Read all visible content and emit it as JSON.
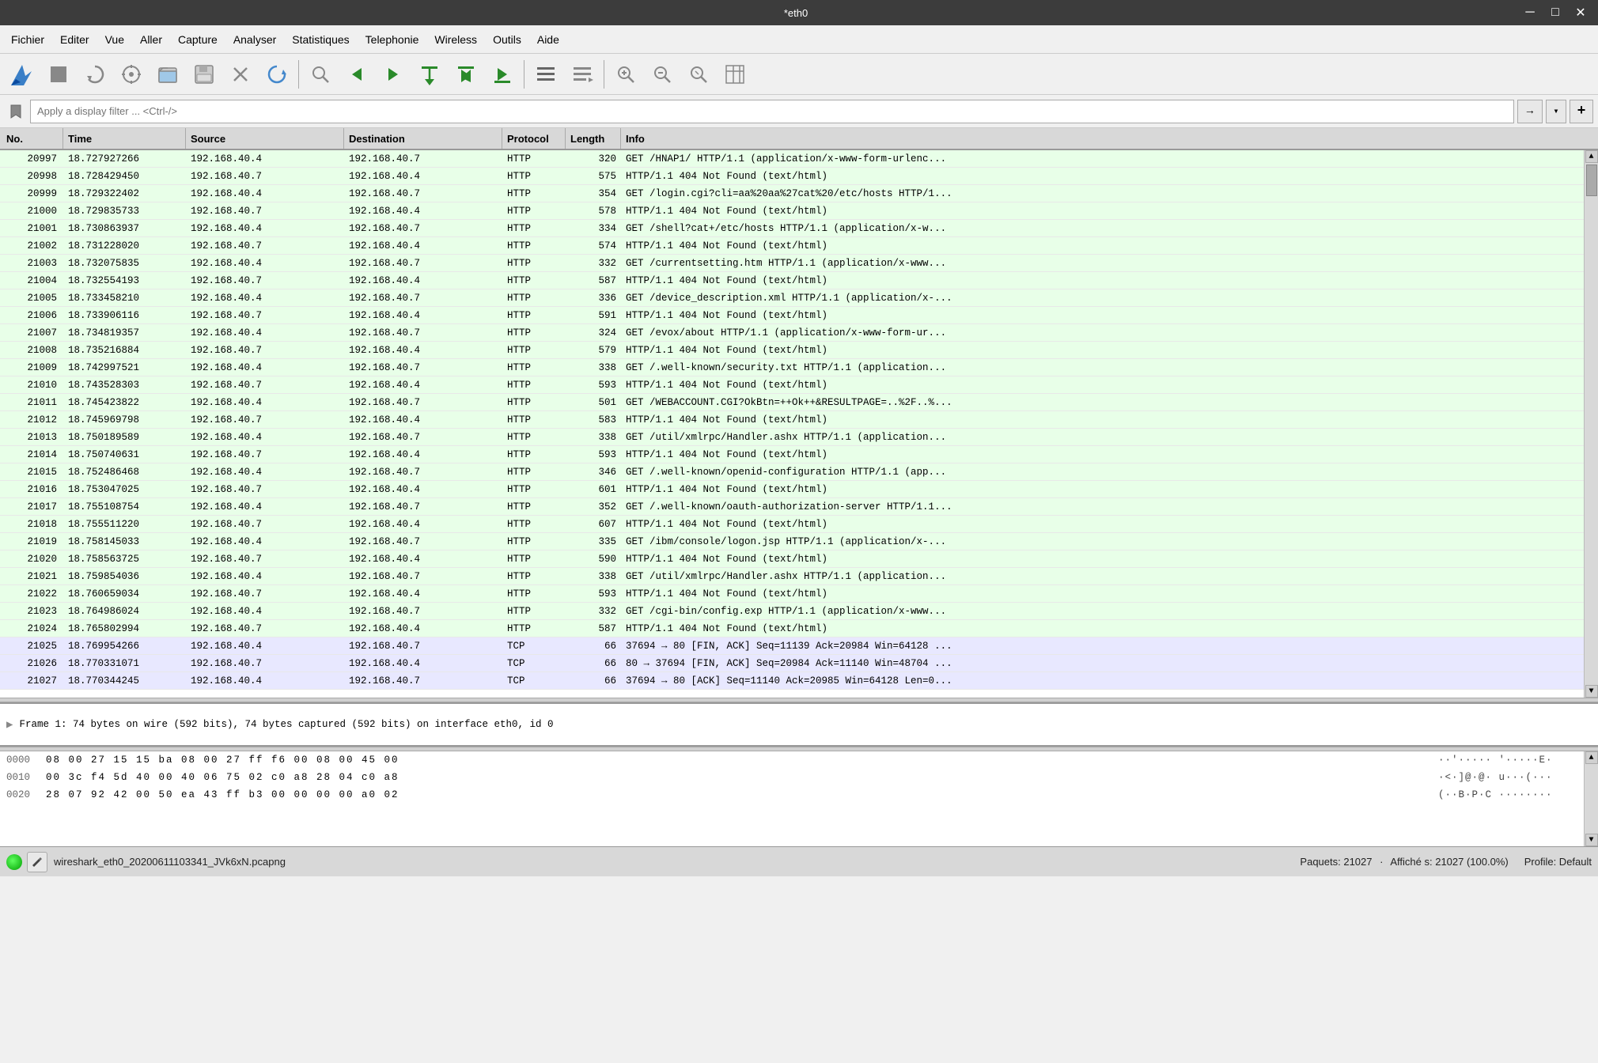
{
  "titlebar": {
    "title": "*eth0",
    "minimize": "─",
    "maximize": "□",
    "close": "✕"
  },
  "menubar": {
    "items": [
      "Fichier",
      "Editer",
      "Vue",
      "Aller",
      "Capture",
      "Analyser",
      "Statistiques",
      "Telephonie",
      "Wireless",
      "Outils",
      "Aide"
    ]
  },
  "toolbar": {
    "buttons": [
      {
        "name": "shark-icon",
        "symbol": "🦈",
        "class": "shark"
      },
      {
        "name": "stop-icon",
        "symbol": "⬛"
      },
      {
        "name": "restart-icon",
        "symbol": "↺"
      },
      {
        "name": "options-icon",
        "symbol": "⚙"
      },
      {
        "name": "open-icon",
        "symbol": "📂"
      },
      {
        "name": "save-icon",
        "symbol": "💾"
      },
      {
        "name": "close-icon",
        "symbol": "✕"
      },
      {
        "name": "reload-icon",
        "symbol": "↻"
      },
      {
        "name": "sep1",
        "type": "sep"
      },
      {
        "name": "find-icon",
        "symbol": "🔍"
      },
      {
        "name": "back-icon",
        "symbol": "◀",
        "class": "green"
      },
      {
        "name": "forward-icon",
        "symbol": "▶",
        "class": "green"
      },
      {
        "name": "goto-icon",
        "symbol": "⤵",
        "class": "green"
      },
      {
        "name": "top-icon",
        "symbol": "⬆",
        "class": "green"
      },
      {
        "name": "bottom-icon",
        "symbol": "⬇",
        "class": "green"
      },
      {
        "name": "sep2",
        "type": "sep"
      },
      {
        "name": "colorize-icon",
        "symbol": "≡"
      },
      {
        "name": "autoscroll-icon",
        "symbol": "≡"
      },
      {
        "name": "sep3",
        "type": "sep"
      },
      {
        "name": "zoom-in-icon",
        "symbol": "🔍"
      },
      {
        "name": "zoom-out-icon",
        "symbol": "🔍"
      },
      {
        "name": "zoom-reset-icon",
        "symbol": "🔍"
      },
      {
        "name": "layout-icon",
        "symbol": "⊞"
      }
    ]
  },
  "filterbar": {
    "placeholder": "Apply a display filter ... <Ctrl-/>",
    "arrow_label": "→",
    "dropdown_label": "▾",
    "plus_label": "+"
  },
  "packetlist": {
    "columns": [
      "No.",
      "Time",
      "Source",
      "Destination",
      "Protocol",
      "Length",
      "Info"
    ],
    "rows": [
      {
        "no": "20997",
        "time": "18.727927266",
        "src": "192.168.40.4",
        "dst": "192.168.40.7",
        "proto": "HTTP",
        "len": "320",
        "info": "GET /HNAP1/ HTTP/1.1  (application/x-www-form-urlenc...",
        "type": "http"
      },
      {
        "no": "20998",
        "time": "18.728429450",
        "src": "192.168.40.7",
        "dst": "192.168.40.4",
        "proto": "HTTP",
        "len": "575",
        "info": "HTTP/1.1 404 Not Found  (text/html)",
        "type": "http"
      },
      {
        "no": "20999",
        "time": "18.729322402",
        "src": "192.168.40.4",
        "dst": "192.168.40.7",
        "proto": "HTTP",
        "len": "354",
        "info": "GET /login.cgi?cli=aa%20aa%27cat%20/etc/hosts HTTP/1...",
        "type": "http"
      },
      {
        "no": "21000",
        "time": "18.729835733",
        "src": "192.168.40.7",
        "dst": "192.168.40.4",
        "proto": "HTTP",
        "len": "578",
        "info": "HTTP/1.1 404 Not Found  (text/html)",
        "type": "http"
      },
      {
        "no": "21001",
        "time": "18.730863937",
        "src": "192.168.40.4",
        "dst": "192.168.40.7",
        "proto": "HTTP",
        "len": "334",
        "info": "GET /shell?cat+/etc/hosts HTTP/1.1  (application/x-w...",
        "type": "http"
      },
      {
        "no": "21002",
        "time": "18.731228020",
        "src": "192.168.40.7",
        "dst": "192.168.40.4",
        "proto": "HTTP",
        "len": "574",
        "info": "HTTP/1.1 404 Not Found  (text/html)",
        "type": "http"
      },
      {
        "no": "21003",
        "time": "18.732075835",
        "src": "192.168.40.4",
        "dst": "192.168.40.7",
        "proto": "HTTP",
        "len": "332",
        "info": "GET /currentsetting.htm HTTP/1.1  (application/x-www...",
        "type": "http"
      },
      {
        "no": "21004",
        "time": "18.732554193",
        "src": "192.168.40.7",
        "dst": "192.168.40.4",
        "proto": "HTTP",
        "len": "587",
        "info": "HTTP/1.1 404 Not Found  (text/html)",
        "type": "http"
      },
      {
        "no": "21005",
        "time": "18.733458210",
        "src": "192.168.40.4",
        "dst": "192.168.40.7",
        "proto": "HTTP",
        "len": "336",
        "info": "GET /device_description.xml HTTP/1.1  (application/x-...",
        "type": "http"
      },
      {
        "no": "21006",
        "time": "18.733906116",
        "src": "192.168.40.7",
        "dst": "192.168.40.4",
        "proto": "HTTP",
        "len": "591",
        "info": "HTTP/1.1 404 Not Found  (text/html)",
        "type": "http"
      },
      {
        "no": "21007",
        "time": "18.734819357",
        "src": "192.168.40.4",
        "dst": "192.168.40.7",
        "proto": "HTTP",
        "len": "324",
        "info": "GET /evox/about HTTP/1.1  (application/x-www-form-ur...",
        "type": "http"
      },
      {
        "no": "21008",
        "time": "18.735216884",
        "src": "192.168.40.7",
        "dst": "192.168.40.4",
        "proto": "HTTP",
        "len": "579",
        "info": "HTTP/1.1 404 Not Found  (text/html)",
        "type": "http"
      },
      {
        "no": "21009",
        "time": "18.742997521",
        "src": "192.168.40.4",
        "dst": "192.168.40.7",
        "proto": "HTTP",
        "len": "338",
        "info": "GET /.well-known/security.txt HTTP/1.1  (application...",
        "type": "http"
      },
      {
        "no": "21010",
        "time": "18.743528303",
        "src": "192.168.40.7",
        "dst": "192.168.40.4",
        "proto": "HTTP",
        "len": "593",
        "info": "HTTP/1.1 404 Not Found  (text/html)",
        "type": "http"
      },
      {
        "no": "21011",
        "time": "18.745423822",
        "src": "192.168.40.4",
        "dst": "192.168.40.7",
        "proto": "HTTP",
        "len": "501",
        "info": "GET /WEBACCOUNT.CGI?OkBtn=++Ok++&RESULTPAGE=..%2F..%...",
        "type": "http"
      },
      {
        "no": "21012",
        "time": "18.745969798",
        "src": "192.168.40.7",
        "dst": "192.168.40.4",
        "proto": "HTTP",
        "len": "583",
        "info": "HTTP/1.1 404 Not Found  (text/html)",
        "type": "http"
      },
      {
        "no": "21013",
        "time": "18.750189589",
        "src": "192.168.40.4",
        "dst": "192.168.40.7",
        "proto": "HTTP",
        "len": "338",
        "info": "GET /util/xmlrpc/Handler.ashx HTTP/1.1  (application...",
        "type": "http"
      },
      {
        "no": "21014",
        "time": "18.750740631",
        "src": "192.168.40.7",
        "dst": "192.168.40.4",
        "proto": "HTTP",
        "len": "593",
        "info": "HTTP/1.1 404 Not Found  (text/html)",
        "type": "http"
      },
      {
        "no": "21015",
        "time": "18.752486468",
        "src": "192.168.40.4",
        "dst": "192.168.40.7",
        "proto": "HTTP",
        "len": "346",
        "info": "GET /.well-known/openid-configuration HTTP/1.1  (app...",
        "type": "http"
      },
      {
        "no": "21016",
        "time": "18.753047025",
        "src": "192.168.40.7",
        "dst": "192.168.40.4",
        "proto": "HTTP",
        "len": "601",
        "info": "HTTP/1.1 404 Not Found  (text/html)",
        "type": "http"
      },
      {
        "no": "21017",
        "time": "18.755108754",
        "src": "192.168.40.4",
        "dst": "192.168.40.7",
        "proto": "HTTP",
        "len": "352",
        "info": "GET /.well-known/oauth-authorization-server HTTP/1.1...",
        "type": "http"
      },
      {
        "no": "21018",
        "time": "18.755511220",
        "src": "192.168.40.7",
        "dst": "192.168.40.4",
        "proto": "HTTP",
        "len": "607",
        "info": "HTTP/1.1 404 Not Found  (text/html)",
        "type": "http"
      },
      {
        "no": "21019",
        "time": "18.758145033",
        "src": "192.168.40.4",
        "dst": "192.168.40.7",
        "proto": "HTTP",
        "len": "335",
        "info": "GET /ibm/console/logon.jsp HTTP/1.1  (application/x-...",
        "type": "http"
      },
      {
        "no": "21020",
        "time": "18.758563725",
        "src": "192.168.40.7",
        "dst": "192.168.40.4",
        "proto": "HTTP",
        "len": "590",
        "info": "HTTP/1.1 404 Not Found  (text/html)",
        "type": "http"
      },
      {
        "no": "21021",
        "time": "18.759854036",
        "src": "192.168.40.4",
        "dst": "192.168.40.7",
        "proto": "HTTP",
        "len": "338",
        "info": "GET /util/xmlrpc/Handler.ashx HTTP/1.1  (application...",
        "type": "http"
      },
      {
        "no": "21022",
        "time": "18.760659034",
        "src": "192.168.40.7",
        "dst": "192.168.40.4",
        "proto": "HTTP",
        "len": "593",
        "info": "HTTP/1.1 404 Not Found  (text/html)",
        "type": "http"
      },
      {
        "no": "21023",
        "time": "18.764986024",
        "src": "192.168.40.4",
        "dst": "192.168.40.7",
        "proto": "HTTP",
        "len": "332",
        "info": "GET /cgi-bin/config.exp HTTP/1.1  (application/x-www...",
        "type": "http"
      },
      {
        "no": "21024",
        "time": "18.765802994",
        "src": "192.168.40.7",
        "dst": "192.168.40.4",
        "proto": "HTTP",
        "len": "587",
        "info": "HTTP/1.1 404 Not Found  (text/html)",
        "type": "http"
      },
      {
        "no": "21025",
        "time": "18.769954266",
        "src": "192.168.40.4",
        "dst": "192.168.40.7",
        "proto": "TCP",
        "len": "66",
        "info": "37694 → 80 [FIN, ACK] Seq=11139 Ack=20984 Win=64128 ...",
        "type": "tcp"
      },
      {
        "no": "21026",
        "time": "18.770331071",
        "src": "192.168.40.7",
        "dst": "192.168.40.4",
        "proto": "TCP",
        "len": "66",
        "info": "80 → 37694 [FIN, ACK] Seq=20984 Ack=11140 Win=48704 ...",
        "type": "tcp"
      },
      {
        "no": "21027",
        "time": "18.770344245",
        "src": "192.168.40.4",
        "dst": "192.168.40.7",
        "proto": "TCP",
        "len": "66",
        "info": "37694 → 80 [ACK] Seq=11140 Ack=20985 Win=64128 Len=0...",
        "type": "tcp"
      }
    ]
  },
  "detailpane": {
    "text": "Frame 1: 74 bytes on wire (592 bits), 74 bytes captured (592 bits) on interface eth0, id 0"
  },
  "hexpane": {
    "rows": [
      {
        "addr": "0000",
        "bytes": "08 00 27 15 15 ba 08 00  27 ff f6 00 08 00 45 00",
        "ascii": "··'····· '·····E·"
      },
      {
        "addr": "0010",
        "bytes": "00 3c f4 5d 40 00 40 06  75 02 c0 a8 28 04 c0 a8",
        "ascii": "·<·]@·@· u···(···"
      },
      {
        "addr": "0020",
        "bytes": "28 07 92 42 00 50 ea 43  ff b3 00 00 00 00 a0 02",
        "ascii": "(··B·P·C ········"
      }
    ]
  },
  "statusbar": {
    "filename": "wireshark_eth0_20200611103341_JVk6xN.pcapng",
    "packets_label": "Paquets: 21027",
    "displayed_label": "Affiché s: 21027 (100.0%)",
    "profile_label": "Profile: Default"
  }
}
